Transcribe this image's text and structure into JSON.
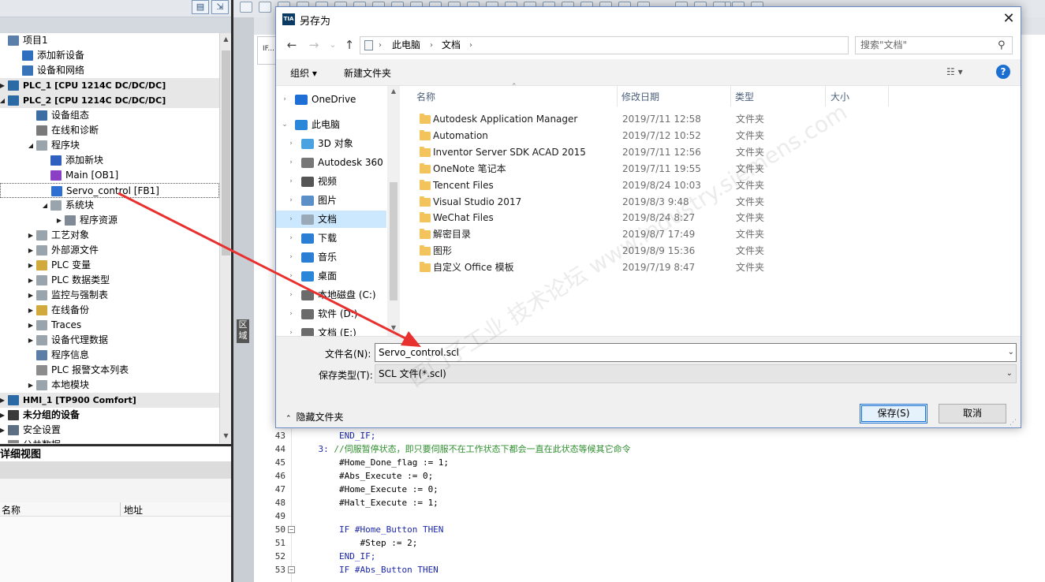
{
  "tree": {
    "items": [
      {
        "label": "项目1",
        "level": 0,
        "arrow": "",
        "icon": "project-icon",
        "color": "#5b7fa8",
        "group": false
      },
      {
        "label": "添加新设备",
        "level": 1,
        "arrow": "",
        "icon": "add-device-icon",
        "color": "#2f6fbf",
        "group": false
      },
      {
        "label": "设备和网络",
        "level": 1,
        "arrow": "",
        "icon": "network-icon",
        "color": "#3a74b8",
        "group": false
      },
      {
        "label": "PLC_1 [CPU 1214C DC/DC/DC]",
        "level": 0,
        "arrow": "▶",
        "icon": "plc-icon",
        "color": "#2c6aa6",
        "group": true
      },
      {
        "label": "PLC_2 [CPU 1214C DC/DC/DC]",
        "level": 0,
        "arrow": "◢",
        "icon": "plc-icon",
        "color": "#2c6aa6",
        "group": true
      },
      {
        "label": "设备组态",
        "level": 2,
        "arrow": "",
        "icon": "device-config-icon",
        "color": "#3d6ea3",
        "group": false
      },
      {
        "label": "在线和诊断",
        "level": 2,
        "arrow": "",
        "icon": "online-diagnostics-icon",
        "color": "#7a7a7a",
        "group": false
      },
      {
        "label": "程序块",
        "level": 2,
        "arrow": "◢",
        "icon": "folder-icon",
        "color": "#9aa4ad",
        "group": false
      },
      {
        "label": "添加新块",
        "level": 3,
        "arrow": "",
        "icon": "add-block-icon",
        "color": "#2f5fbf",
        "group": false
      },
      {
        "label": "Main [OB1]",
        "level": 3,
        "arrow": "",
        "icon": "ob-block-icon",
        "color": "#8a3fc4",
        "group": false
      },
      {
        "label": "Servo_control [FB1]",
        "level": 3,
        "arrow": "",
        "icon": "fb-block-icon",
        "color": "#2f6fd1",
        "group": false,
        "selected": true
      },
      {
        "label": "系统块",
        "level": 3,
        "arrow": "◢",
        "icon": "folder-icon",
        "color": "#9aa4ad",
        "group": false
      },
      {
        "label": "程序资源",
        "level": 4,
        "arrow": "▶",
        "icon": "resource-icon",
        "color": "#7f8a96",
        "group": false
      },
      {
        "label": "工艺对象",
        "level": 2,
        "arrow": "▶",
        "icon": "folder-icon",
        "color": "#9aa4ad",
        "group": false
      },
      {
        "label": "外部源文件",
        "level": 2,
        "arrow": "▶",
        "icon": "folder-icon",
        "color": "#9aa4ad",
        "group": false
      },
      {
        "label": "PLC 变量",
        "level": 2,
        "arrow": "▶",
        "icon": "folder-icon",
        "color": "#d1a93c",
        "group": false
      },
      {
        "label": "PLC 数据类型",
        "level": 2,
        "arrow": "▶",
        "icon": "folder-icon",
        "color": "#9aa4ad",
        "group": false
      },
      {
        "label": "监控与强制表",
        "level": 2,
        "arrow": "▶",
        "icon": "folder-icon",
        "color": "#9aa4ad",
        "group": false
      },
      {
        "label": "在线备份",
        "level": 2,
        "arrow": "▶",
        "icon": "folder-icon",
        "color": "#d1a93c",
        "group": false
      },
      {
        "label": "Traces",
        "level": 2,
        "arrow": "▶",
        "icon": "folder-icon",
        "color": "#9aa4ad",
        "group": false
      },
      {
        "label": "设备代理数据",
        "level": 2,
        "arrow": "▶",
        "icon": "folder-icon",
        "color": "#9aa4ad",
        "group": false
      },
      {
        "label": "程序信息",
        "level": 2,
        "arrow": "",
        "icon": "program-info-icon",
        "color": "#5c7ea6",
        "group": false
      },
      {
        "label": "PLC 报警文本列表",
        "level": 2,
        "arrow": "",
        "icon": "alarm-text-icon",
        "color": "#8c8c8c",
        "group": false
      },
      {
        "label": "本地模块",
        "level": 2,
        "arrow": "▶",
        "icon": "folder-icon",
        "color": "#9aa4ad",
        "group": false
      },
      {
        "label": "HMI_1 [TP900 Comfort]",
        "level": 0,
        "arrow": "▶",
        "icon": "hmi-icon",
        "color": "#2c6aa6",
        "group": true
      },
      {
        "label": "未分组的设备",
        "level": 0,
        "arrow": "▶",
        "icon": "devices-icon",
        "color": "#3a3a3a",
        "group": false,
        "bold": true
      },
      {
        "label": "安全设置",
        "level": 0,
        "arrow": "▶",
        "icon": "security-icon",
        "color": "#5d6f82",
        "group": false
      },
      {
        "label": "公共数据",
        "level": 0,
        "arrow": "▶",
        "icon": "common-data-icon",
        "color": "#8a8a8a",
        "group": false
      }
    ]
  },
  "detail": {
    "title": "详细视图",
    "col_name": "名称",
    "col_address": "地址"
  },
  "editor": {
    "tab_label": "IF...",
    "strip_label": "区域",
    "lines": [
      {
        "n": "43",
        "fold": "",
        "segments": [
          {
            "t": "        END_IF;",
            "c": "kw"
          }
        ]
      },
      {
        "n": "44",
        "fold": "",
        "segments": [
          {
            "t": "    3: ",
            "c": "kw"
          },
          {
            "t": "//伺服暂停状态，即只要伺服不在工作状态下都会一直在此状态等候其它命令",
            "c": "cm"
          }
        ]
      },
      {
        "n": "45",
        "fold": "",
        "segments": [
          {
            "t": "        #Home_Done_flag := 1;",
            "c": "num"
          }
        ]
      },
      {
        "n": "46",
        "fold": "",
        "segments": [
          {
            "t": "        #Abs_Execute := 0;",
            "c": "num"
          }
        ]
      },
      {
        "n": "47",
        "fold": "",
        "segments": [
          {
            "t": "        #Home_Execute := 0;",
            "c": "num"
          }
        ]
      },
      {
        "n": "48",
        "fold": "",
        "segments": [
          {
            "t": "        #Halt_Execute := 1;",
            "c": "num"
          }
        ]
      },
      {
        "n": "49",
        "fold": "",
        "segments": [
          {
            "t": "",
            "c": "num"
          }
        ]
      },
      {
        "n": "50",
        "fold": "⊟",
        "segments": [
          {
            "t": "        IF #Home_Button THEN",
            "c": "kw"
          }
        ]
      },
      {
        "n": "51",
        "fold": "",
        "segments": [
          {
            "t": "            #Step := 2;",
            "c": "num"
          }
        ]
      },
      {
        "n": "52",
        "fold": "",
        "segments": [
          {
            "t": "        END_IF;",
            "c": "kw"
          }
        ]
      },
      {
        "n": "53",
        "fold": "⊟",
        "segments": [
          {
            "t": "        IF #Abs_Button THEN",
            "c": "kw"
          }
        ]
      }
    ]
  },
  "dialog": {
    "title": "另存为",
    "logo": "TIA",
    "close": "✕",
    "nav": {
      "back": "←",
      "forward": "→",
      "recent": "⌄",
      "up": "↑"
    },
    "breadcrumb": [
      "此电脑",
      "文档"
    ],
    "breadcrumb_sep": "›",
    "search_placeholder": "搜索\"文档\"",
    "toolbar": {
      "organize": "组织 ▾",
      "new_folder": "新建文件夹",
      "view": "☷ ▾",
      "help": "?"
    },
    "nav_pane": [
      {
        "label": "OneDrive",
        "level": 0,
        "chev": "›",
        "icon": "onedrive-icon",
        "color": "#1d6fd6"
      },
      {
        "label": "此电脑",
        "level": 0,
        "chev": "⌄",
        "icon": "computer-icon",
        "color": "#2a86d8"
      },
      {
        "label": "3D 对象",
        "level": 1,
        "chev": "›",
        "icon": "3d-objects-icon",
        "color": "#4aa3e0"
      },
      {
        "label": "Autodesk 360",
        "level": 1,
        "chev": "›",
        "icon": "cloud-icon",
        "color": "#777"
      },
      {
        "label": "视频",
        "level": 1,
        "chev": "›",
        "icon": "video-icon",
        "color": "#555"
      },
      {
        "label": "图片",
        "level": 1,
        "chev": "›",
        "icon": "pictures-icon",
        "color": "#5a8fc7"
      },
      {
        "label": "文档",
        "level": 1,
        "chev": "›",
        "icon": "documents-icon",
        "color": "#9aa9b8",
        "selected": true
      },
      {
        "label": "下载",
        "level": 1,
        "chev": "›",
        "icon": "download-icon",
        "color": "#2a7fd4"
      },
      {
        "label": "音乐",
        "level": 1,
        "chev": "›",
        "icon": "music-icon",
        "color": "#2a7fd4"
      },
      {
        "label": "桌面",
        "level": 1,
        "chev": "›",
        "icon": "desktop-icon",
        "color": "#2a86d8"
      },
      {
        "label": "本地磁盘 (C:)",
        "level": 1,
        "chev": "›",
        "icon": "drive-icon",
        "color": "#6b6b6b"
      },
      {
        "label": "软件 (D:)",
        "level": 1,
        "chev": "›",
        "icon": "drive-icon",
        "color": "#6b6b6b"
      },
      {
        "label": "文档 (E:)",
        "level": 1,
        "chev": "›",
        "icon": "drive-icon",
        "color": "#6b6b6b"
      }
    ],
    "columns": {
      "name": "名称",
      "date": "修改日期",
      "type": "类型",
      "size": "大小"
    },
    "files": [
      {
        "name": "Autodesk Application Manager",
        "date": "2019/7/11 12:58",
        "type": "文件夹"
      },
      {
        "name": "Automation",
        "date": "2019/7/12 10:52",
        "type": "文件夹"
      },
      {
        "name": "Inventor Server SDK ACAD 2015",
        "date": "2019/7/11 12:56",
        "type": "文件夹"
      },
      {
        "name": "OneNote 笔记本",
        "date": "2019/7/11 19:55",
        "type": "文件夹"
      },
      {
        "name": "Tencent Files",
        "date": "2019/8/24 10:03",
        "type": "文件夹"
      },
      {
        "name": "Visual Studio 2017",
        "date": "2019/8/3 9:48",
        "type": "文件夹"
      },
      {
        "name": "WeChat Files",
        "date": "2019/8/24 8:27",
        "type": "文件夹"
      },
      {
        "name": "解密目录",
        "date": "2019/8/7 17:49",
        "type": "文件夹"
      },
      {
        "name": "图形",
        "date": "2019/8/9 15:36",
        "type": "文件夹"
      },
      {
        "name": "自定义 Office 模板",
        "date": "2019/7/19 8:47",
        "type": "文件夹"
      }
    ],
    "filename_label": "文件名(N):",
    "filename_value": "Servo_control.scl",
    "filetype_label": "保存类型(T):",
    "filetype_value": "SCL 文件(*.scl)",
    "hide_folders": "隐藏文件夹",
    "save": "保存(S)",
    "cancel": "取消"
  },
  "watermark": "西门子工业 技术论坛 www.industry.siemens.com",
  "colors": {
    "accent": "#1a6fd1",
    "selection": "#cce8ff",
    "annotation": "#e8312f"
  }
}
